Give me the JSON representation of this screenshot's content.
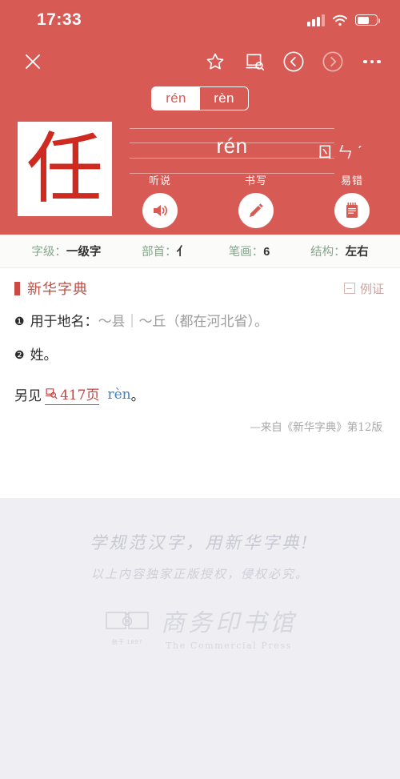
{
  "status_bar": {
    "time": "17:33",
    "signal_icon": "signal-bars-icon",
    "wifi_icon": "wifi-icon",
    "battery_icon": "battery-icon",
    "battery_level_pct": 62
  },
  "nav": {
    "close_icon": "close-icon",
    "items": [
      {
        "name": "favorite-star-icon",
        "label": "收藏"
      },
      {
        "name": "book-search-icon",
        "label": "查词"
      },
      {
        "name": "prev-char-icon",
        "label": "上一个"
      },
      {
        "name": "next-char-icon",
        "label": "下一个"
      },
      {
        "name": "more-options-icon",
        "label": "更多"
      }
    ]
  },
  "pronunciation_toggle": {
    "options": [
      {
        "label": "rén",
        "selected": true
      },
      {
        "label": "rèn",
        "selected": false
      }
    ]
  },
  "character": {
    "glyph": "任",
    "pinyin": "rén",
    "zhuyin": "ㄖㄣˊ"
  },
  "actions": [
    {
      "label": "听说",
      "icon": "speaker-icon"
    },
    {
      "label": "书写",
      "icon": "pencil-icon"
    },
    {
      "label": "易错",
      "icon": "notebook-icon"
    }
  ],
  "info_bar": [
    {
      "key": "字级：",
      "value": "一级字"
    },
    {
      "key": "部首：",
      "value": "亻"
    },
    {
      "key": "笔画：",
      "value": "6"
    },
    {
      "key": "结构：",
      "value": "左右"
    }
  ],
  "dictionary": {
    "section_title": "新华字典",
    "example_toggle_label": "例证",
    "example_toggle_icon": "collapse-minus-icon",
    "definitions": [
      {
        "number": "❶",
        "text": "用于地名：",
        "example": "〜县｜〜丘（都在河北省）。"
      },
      {
        "number": "❷",
        "text": "姓。",
        "example": ""
      }
    ],
    "see_also": {
      "prefix": "另见",
      "link_icon": "book-lookup-icon",
      "page": "417页",
      "reading": "rèn",
      "suffix": "。"
    },
    "source": "—来自《新华字典》第12版"
  },
  "footer": {
    "slogan": "学规范汉字，用新华字典!",
    "copyright": "以上内容独家正版授权，侵权必究。",
    "logo": {
      "icon": "open-book-logo-icon",
      "established": "创于 1897",
      "name_cn": "商务印书馆",
      "name_en": "The Commercial Press"
    }
  },
  "colors": {
    "header_red": "#d85a55",
    "char_red": "#cf2a20",
    "accent_red": "#c9423c",
    "link_blue": "#3f7fd0",
    "info_key_green": "#86a58c",
    "footer_bg": "#eeeef3"
  }
}
